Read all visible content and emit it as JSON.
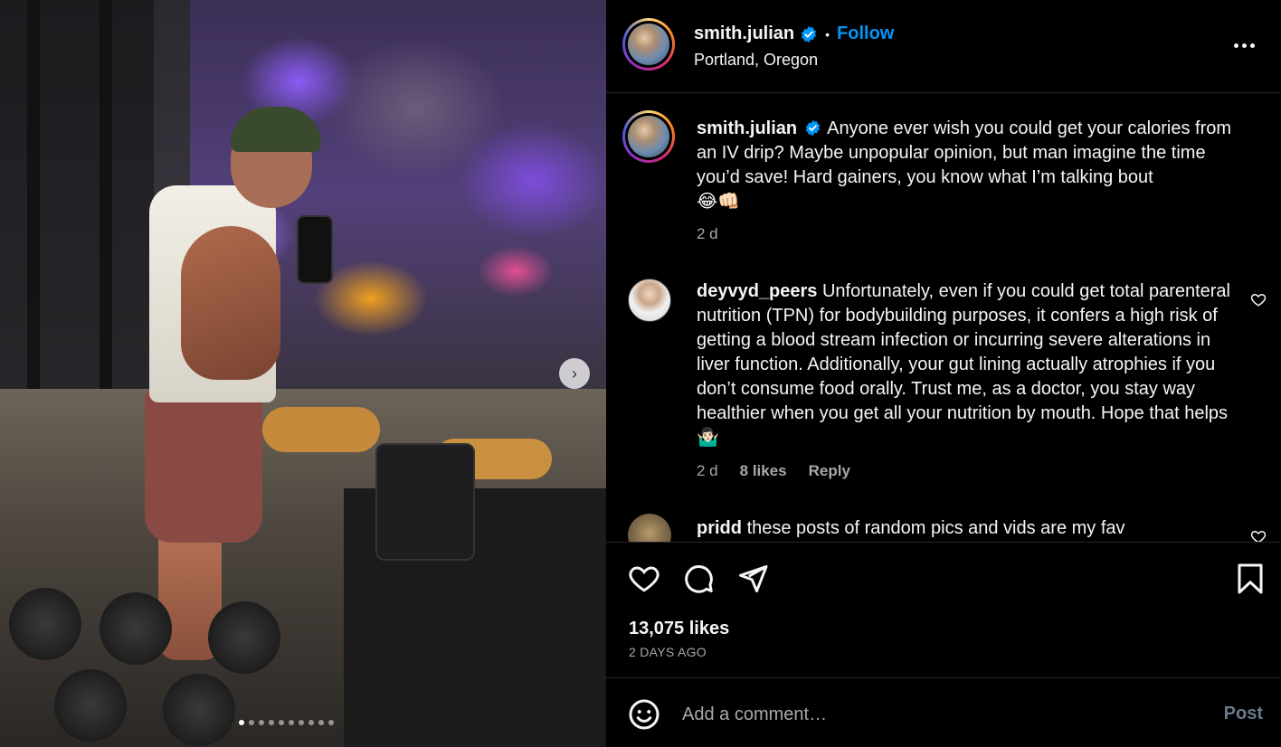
{
  "media": {
    "next_icon": "chevron-right-icon",
    "carousel_count": 10,
    "carousel_active": 1
  },
  "header": {
    "username": "smith.julian",
    "separator": "•",
    "follow_label": "Follow",
    "location": "Portland, Oregon",
    "more_icon": "more-horizontal-icon"
  },
  "caption": {
    "username": "smith.julian",
    "text": "Anyone ever wish you could get your calories from an IV drip? Maybe unpopular opinion, but man imagine the time you’d save! Hard gainers, you know what I’m talking bout",
    "emojis": "😂👊🏻",
    "time": "2 d"
  },
  "comments": [
    {
      "username": "deyvyd_peers",
      "text": "Unfortunately, even if you could get total parenteral nutrition (TPN) for bodybuilding purposes, it confers a high risk of getting a blood stream infection or incurring severe alterations in liver function. Additionally, your gut lining actually atrophies if you don’t consume food orally. Trust me, as a doctor, you stay way healthier when you get all your nutrition by mouth. Hope that helps",
      "emoji": "🤷🏻‍♂️",
      "time": "2 d",
      "likes": "8 likes",
      "reply": "Reply"
    },
    {
      "username": "pridd",
      "text": "these posts of random pics and vids are my fav"
    }
  ],
  "actions": {
    "likes": "13,075 likes",
    "time": "2 DAYS AGO"
  },
  "composer": {
    "placeholder": "Add a comment…",
    "post_label": "Post"
  },
  "colors": {
    "accent": "#0095f6",
    "background": "#000000",
    "muted": "#a8a8a8",
    "divider": "#262626"
  }
}
